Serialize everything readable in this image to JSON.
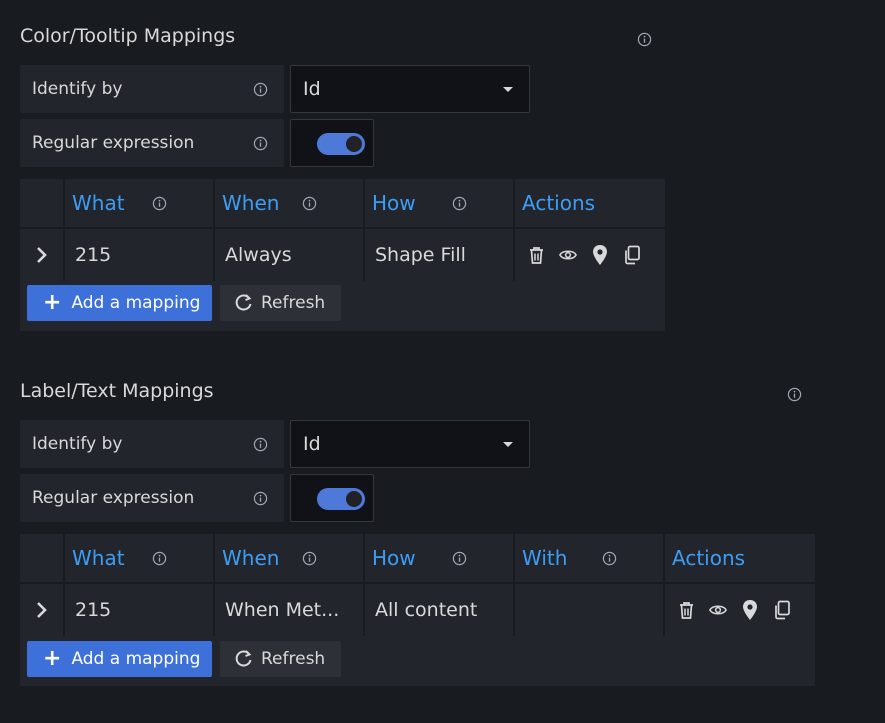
{
  "color_section": {
    "title": "Color/Tooltip Mappings",
    "identify_by_label": "Identify by",
    "identify_by_value": "Id",
    "regex_label": "Regular expression",
    "regex_enabled": true,
    "columns": [
      "What",
      "When",
      "How",
      "Actions"
    ],
    "row": {
      "what": "215",
      "when": "Always",
      "how": "Shape Fill"
    },
    "add_label": "Add a mapping",
    "refresh_label": "Refresh"
  },
  "label_section": {
    "title": "Label/Text Mappings",
    "identify_by_label": "Identify by",
    "identify_by_value": "Id",
    "regex_label": "Regular expression",
    "regex_enabled": true,
    "columns": [
      "What",
      "When",
      "How",
      "With",
      "Actions"
    ],
    "row": {
      "what": "215",
      "when": "When Met...",
      "how": "All content",
      "with": ""
    },
    "add_label": "Add a mapping",
    "refresh_label": "Refresh"
  },
  "icons": [
    "info-icon",
    "caret-down-icon",
    "chevron-right-icon",
    "trash-icon",
    "eye-icon",
    "map-pin-icon",
    "copy-icon",
    "plus-icon",
    "refresh-icon"
  ],
  "colors": {
    "background": "#181b1f",
    "panel": "#22252b",
    "header_text": "#3d9df5",
    "primary_button": "#3d71d9",
    "toggle_on": "#4e79d8"
  }
}
